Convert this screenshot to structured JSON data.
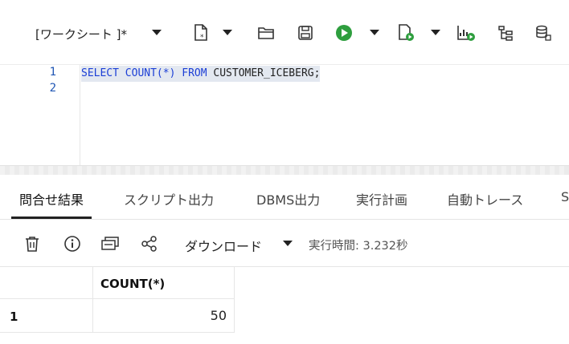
{
  "toolbar": {
    "worksheet_label": "[ワークシート ]*",
    "icons": [
      "new-file-icon",
      "open-folder-icon",
      "save-icon",
      "run-statement-icon",
      "run-script-icon",
      "explain-plan-icon",
      "autotrace-icon",
      "database-actions-icon"
    ],
    "accent_green": "#2e9e3e"
  },
  "editor": {
    "lines": [
      {
        "number": "1",
        "tokens": [
          {
            "text": "SELECT",
            "type": "keyword"
          },
          {
            "text": " ",
            "type": "plain"
          },
          {
            "text": "COUNT(*)",
            "type": "keyword"
          },
          {
            "text": " ",
            "type": "plain"
          },
          {
            "text": "FROM",
            "type": "keyword"
          },
          {
            "text": " CUSTOMER_ICEBERG;",
            "type": "plain"
          }
        ]
      },
      {
        "number": "2",
        "tokens": []
      }
    ]
  },
  "result_tabs": [
    {
      "label": "問合せ結果",
      "active": true
    },
    {
      "label": "スクリプト出力",
      "active": false
    },
    {
      "label": "DBMS出力",
      "active": false
    },
    {
      "label": "実行計画",
      "active": false
    },
    {
      "label": "自動トレース",
      "active": false
    },
    {
      "label": "S",
      "active": false
    }
  ],
  "results_toolbar": {
    "icons": [
      "delete-icon",
      "info-icon",
      "single-record-view-icon",
      "share-icon"
    ],
    "download_label": "ダウンロード",
    "exec_time": "実行時間: 3.232秒"
  },
  "grid": {
    "columns": [
      "COUNT(*)"
    ],
    "rows": [
      {
        "row_number": "1",
        "values": [
          "50"
        ]
      }
    ]
  }
}
